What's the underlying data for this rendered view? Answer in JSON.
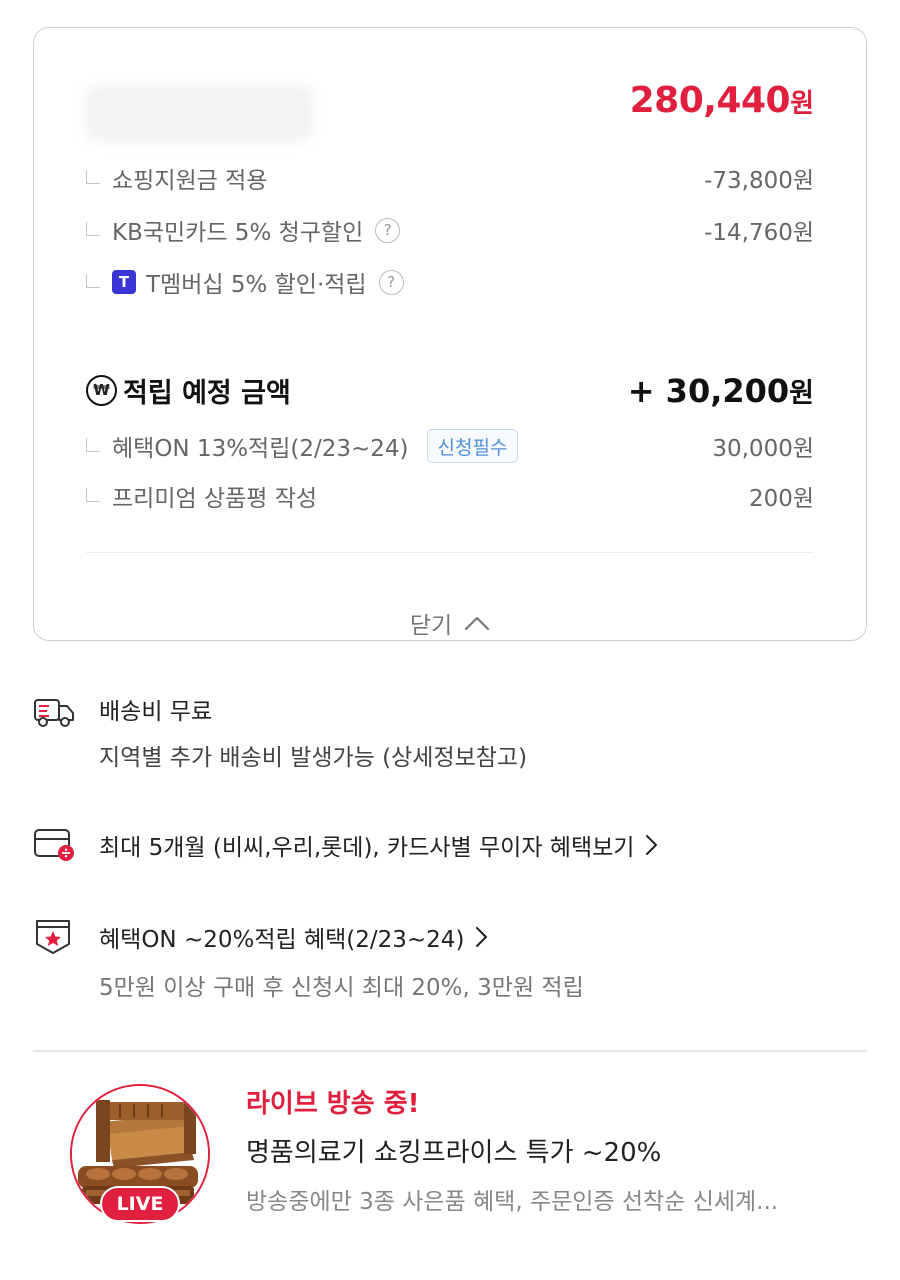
{
  "price_card": {
    "final_price": "280,440",
    "currency": "원",
    "discounts": [
      {
        "label": "쇼핑지원금 적용",
        "value": "-73,800원",
        "has_help": false
      },
      {
        "label": "KB국민카드 5% 청구할인",
        "value": "-14,760원",
        "has_help": true
      },
      {
        "label": "T멤버십 5% 할인·적립",
        "value": "",
        "has_help": true,
        "badge": "T"
      }
    ],
    "earn": {
      "icon_symbol": "₩",
      "label": "적립 예정 금액",
      "value": "+ 30,200",
      "currency": "원"
    },
    "earn_items": [
      {
        "label": "혜택ON 13%적립(2/23~24)",
        "tag": "신청필수",
        "value": "30,000원"
      },
      {
        "label": "프리미엄 상품평 작성",
        "value": "200원"
      }
    ],
    "close_label": "닫기"
  },
  "shipping": {
    "icon": "truck-icon",
    "title": "배송비 무료",
    "subtitle": "지역별 추가 배송비 발생가능 (상세정보참고)"
  },
  "installment": {
    "icon": "card-icon",
    "title": "최대 5개월 (비씨,우리,롯데), 카드사별 무이자 혜택보기"
  },
  "benefit": {
    "icon": "star-shield-icon",
    "title": "혜택ON ~20%적립 혜택(2/23~24)",
    "subtitle": "5만원 이상 구매 후 신청시 최대 20%, 3만원 적립"
  },
  "live": {
    "badge": "LIVE",
    "title": "라이브 방송 중!",
    "headline": "명품의료기 쇼킹프라이스 특가 ~20%",
    "description": "방송중에만 3종 사은품 혜택, 주문인증 선착순 신세계..."
  },
  "colors": {
    "accent": "#e0203e",
    "tag_blue": "#4e8fd8",
    "t_badge": "#3b35d6"
  }
}
